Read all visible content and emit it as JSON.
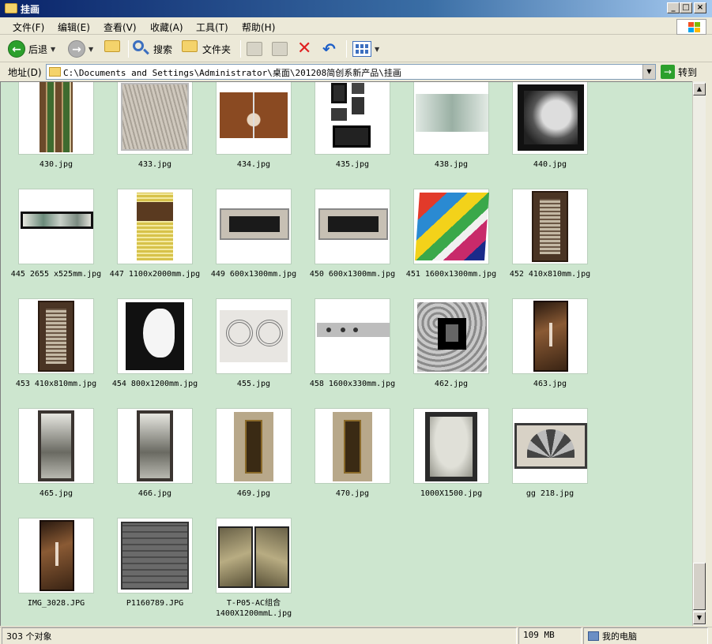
{
  "window": {
    "title": "挂画"
  },
  "menu": [
    "文件(F)",
    "编辑(E)",
    "查看(V)",
    "收藏(A)",
    "工具(T)",
    "帮助(H)"
  ],
  "toolbar": {
    "back": "后退",
    "search": "搜索",
    "folders": "文件夹"
  },
  "address": {
    "label": "地址(D)",
    "value": "C:\\Documents and Settings\\Administrator\\桌面\\201208简创系新产品\\挂画",
    "go": "转到"
  },
  "files": [
    {
      "name": "430.jpg",
      "art": "tall-stripes"
    },
    {
      "name": "433.jpg",
      "art": "grey-texture"
    },
    {
      "name": "434.jpg",
      "art": "brown-tree"
    },
    {
      "name": "435.jpg",
      "art": "multi-frames"
    },
    {
      "name": "438.jpg",
      "art": "pale-wide"
    },
    {
      "name": "440.jpg",
      "art": "dark-frame"
    },
    {
      "name": "445 2655 x525mm.jpg",
      "art": "long-panorama"
    },
    {
      "name": "447 1100x2000mm.jpg",
      "art": "yellow-stripes"
    },
    {
      "name": "449 600x1300mm.jpg",
      "art": "wide-dark-inset"
    },
    {
      "name": "450 600x1300mm.jpg",
      "art": "wide-dark-inset"
    },
    {
      "name": "451 1600x1300mm.jpg",
      "art": "colorful-abstract"
    },
    {
      "name": "452 410x810mm.jpg",
      "art": "tall-brown-mosaic"
    },
    {
      "name": "453 410x810mm.jpg",
      "art": "tall-brown-mosaic"
    },
    {
      "name": "454 800x1200mm.jpg",
      "art": "bw-face"
    },
    {
      "name": "455.jpg",
      "art": "roses"
    },
    {
      "name": "458 1600x330mm.jpg",
      "art": "long-grey"
    },
    {
      "name": "462.jpg",
      "art": "marble-center"
    },
    {
      "name": "463.jpg",
      "art": "tall-bronze"
    },
    {
      "name": "465.jpg",
      "art": "tall-ink"
    },
    {
      "name": "466.jpg",
      "art": "tall-ink"
    },
    {
      "name": "469.jpg",
      "art": "tall-carved"
    },
    {
      "name": "470.jpg",
      "art": "tall-carved"
    },
    {
      "name": "1000X1500.jpg",
      "art": "dark-tree"
    },
    {
      "name": "gg 218.jpg",
      "art": "fan"
    },
    {
      "name": "IMG_3028.JPG",
      "art": "tall-bronze"
    },
    {
      "name": "P1160789.JPG",
      "art": "stone-relief"
    },
    {
      "name": "T-P05-AC组合\n1400X1200mmL.jpg",
      "art": "gold-diptych"
    }
  ],
  "status": {
    "count": "303 个对象",
    "size": "109 MB",
    "location": "我的电脑"
  },
  "colors": {
    "content_bg": "#cde6cf",
    "title_bar": "#0a246a"
  }
}
